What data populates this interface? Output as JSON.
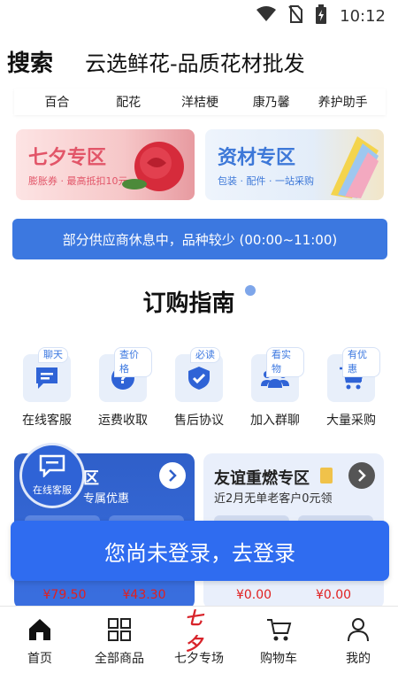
{
  "status_bar": {
    "time": "10:12"
  },
  "header": {
    "title": "搜索",
    "subtitle": "云选鲜花-品质花材批发"
  },
  "categories": [
    "百合",
    "配花",
    "洋桔梗",
    "康乃馨",
    "养护助手"
  ],
  "promos": [
    {
      "title": "七夕专区",
      "subtitle": "膨胀券 · 最高抵扣10元"
    },
    {
      "title": "资材专区",
      "subtitle": "包装 · 配件 · 一站采购"
    }
  ],
  "notice": "部分供应商休息中，品种较少 (00:00~11:00)",
  "guide": {
    "title": "订购指南",
    "items": [
      {
        "tag": "聊天",
        "label": "在线客服",
        "icon": "chat-icon"
      },
      {
        "tag": "查价格",
        "label": "运费收取",
        "icon": "question-icon"
      },
      {
        "tag": "必读",
        "label": "售后协议",
        "icon": "shield-check-icon"
      },
      {
        "tag": "看实物",
        "label": "加入群聊",
        "icon": "group-icon"
      },
      {
        "tag": "有优惠",
        "label": "大量采购",
        "icon": "cart-icon"
      }
    ]
  },
  "features": {
    "left": {
      "title": "区",
      "subtitle": "专属优惠",
      "prices": [
        "¥79.50",
        "¥43.30"
      ]
    },
    "right": {
      "title": "友谊重燃专区",
      "subtitle": "近2月无单老客户0元领",
      "prices": [
        "¥0.00",
        "¥0.00"
      ]
    }
  },
  "online_service": {
    "label": "在线客服"
  },
  "login_banner": "您尚未登录，去登录",
  "tabbar": [
    {
      "label": "首页",
      "icon": "home-icon"
    },
    {
      "label": "全部商品",
      "icon": "grid-icon"
    },
    {
      "label": "七夕专场",
      "glyph": "七夕",
      "icon": "qixi-logo-icon"
    },
    {
      "label": "购物车",
      "icon": "cart-icon"
    },
    {
      "label": "我的",
      "icon": "user-icon"
    }
  ],
  "colors": {
    "primary": "#2f6cf0",
    "notice_bg": "#3c78e0",
    "price": "#e02020",
    "accent_red": "#d8232a"
  }
}
